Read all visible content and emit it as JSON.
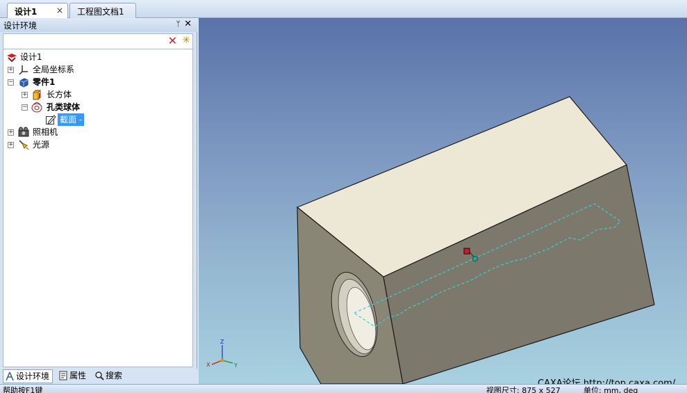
{
  "doc_tabs": {
    "active": "设计1",
    "active_close": "×",
    "other": "工程图文档1"
  },
  "panel": {
    "title": "设计环境",
    "pin": "ᛘ",
    "close": "✕",
    "toolbar": {
      "delete_icon": "✕",
      "wizard_icon": "✳"
    },
    "tree": [
      {
        "label": "设计1",
        "icon": "design-icon"
      },
      {
        "label": "全局坐标系",
        "icon": "coordinate-system-icon"
      },
      {
        "label": "零件1",
        "icon": "part-icon"
      },
      {
        "label": "长方体",
        "icon": "box-icon"
      },
      {
        "label": "孔类球体",
        "icon": "hole-sphere-icon"
      },
      {
        "label": "截面 -",
        "icon": "section-icon"
      },
      {
        "label": "照相机",
        "icon": "camera-icon"
      },
      {
        "label": "光源",
        "icon": "light-icon"
      }
    ],
    "bottom_tabs": [
      "设计环境",
      "属性",
      "搜索"
    ]
  },
  "viewport": {
    "watermark": "CAXA论坛  http://top.caxa.com/",
    "axes": {
      "x": "X",
      "y": "Y",
      "z": "Z"
    },
    "colors": {
      "top_face": "#ede8d6",
      "front_face": "#8a8676",
      "side_face": "#7c796c",
      "section_outline": "#38d0d8",
      "handle": "#c02030"
    }
  },
  "status": {
    "help": "帮助按F1键",
    "view_size": "视图尺寸: 875 x 527",
    "units": "单位: mm, deg"
  }
}
